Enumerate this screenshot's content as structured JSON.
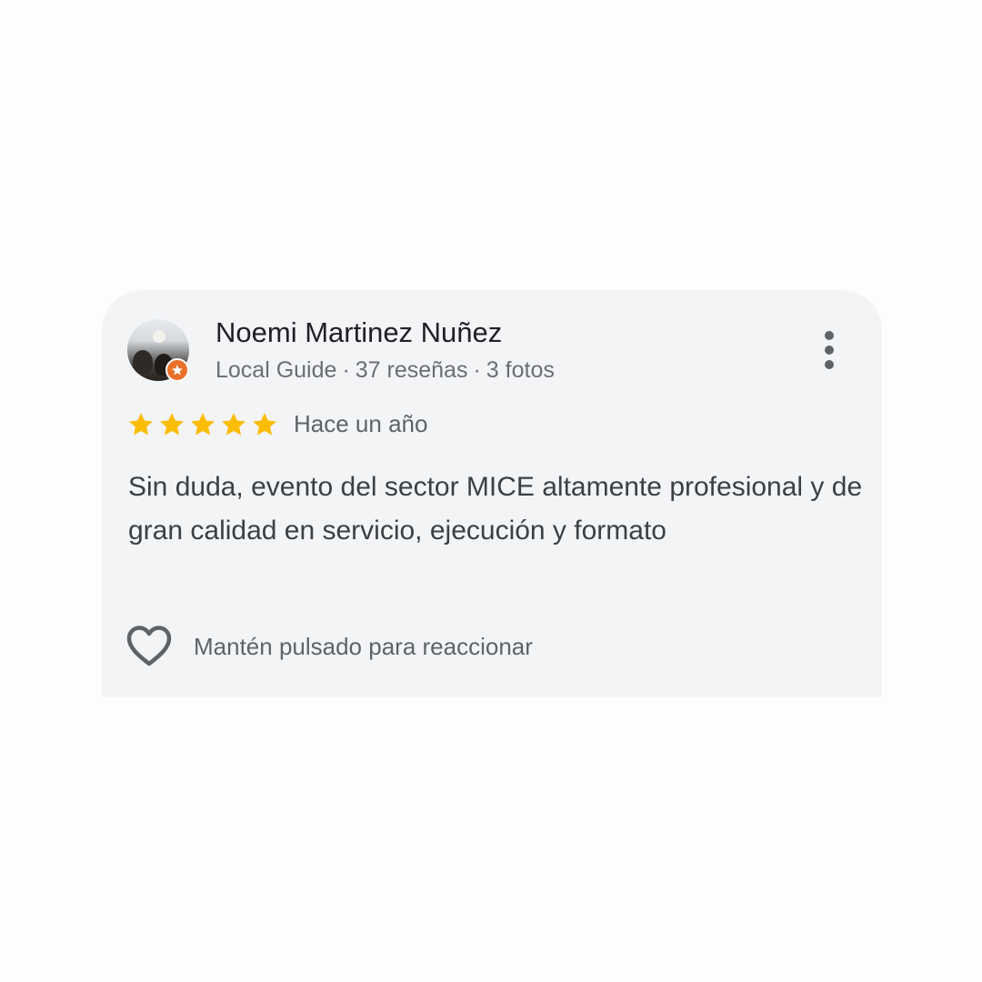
{
  "review": {
    "author_name": "Noemi Martinez Nuñez",
    "author_level": "Local Guide",
    "reviews_count": "37 reseñas",
    "photos_count": "3 fotos",
    "separator": "·",
    "rating": 5,
    "max_rating": 5,
    "time_ago": "Hace un año",
    "text": "Sin duda, evento del sector MICE altamente profesional y de gran calidad en servicio, ejecución y formato",
    "reaction_hint": "Mantén pulsado para reaccionar"
  },
  "icons": {
    "more": "more-vertical-icon",
    "star": "star-icon",
    "heart": "heart-outline-icon",
    "badge": "local-guide-star-badge-icon"
  },
  "colors": {
    "card_background": "#f3f4f6",
    "star": "#fbbc04",
    "badge": "#e8702a",
    "author_text": "#202124",
    "secondary_text": "#5f6368"
  }
}
